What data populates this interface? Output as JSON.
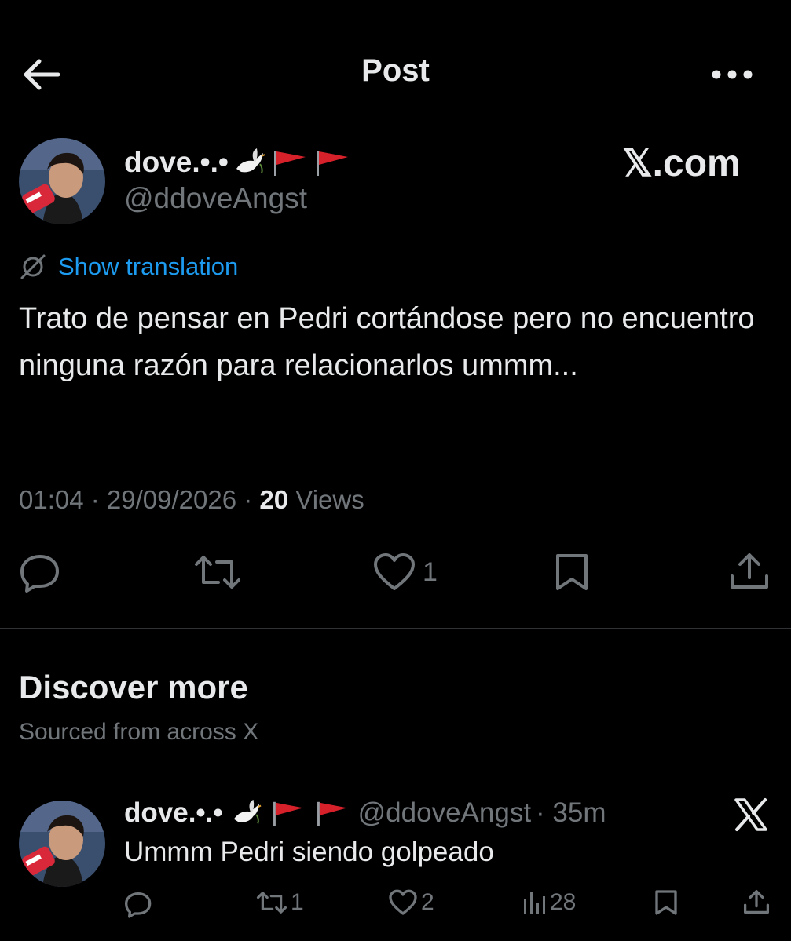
{
  "header": {
    "title": "Post"
  },
  "post": {
    "name": "dove.•.•",
    "handle": "@ddoveAngst",
    "source_badge": "𝕏.com",
    "translate_label": "Show translation",
    "text": "Trato de pensar en Pedri cortándose pero no encuentro ninguna razón para relacionarlos ummm...",
    "time": "01:04 · 29/09/2026 · ",
    "views_count": "20",
    "views_label": " Views",
    "likes": "1"
  },
  "discover": {
    "title": "Discover more",
    "subtitle": "Sourced from across X"
  },
  "related_post": {
    "name": "dove.•.•",
    "handle": "@ddoveAngst",
    "time": "· 35m",
    "text": "Ummm Pedri siendo golpeado",
    "retweets": "1",
    "likes": "2",
    "views": "28"
  },
  "colors": {
    "accent": "#1d9bf0",
    "muted": "#71767b",
    "text": "#e7e9ea",
    "background": "#000000",
    "flag": "#d6212b"
  },
  "icons": [
    "back-arrow-icon",
    "more-icon",
    "dove-icon",
    "red-flag-icon",
    "translate-icon",
    "reply-icon",
    "retweet-icon",
    "like-icon",
    "bookmark-icon",
    "share-icon",
    "views-icon",
    "x-logo-icon"
  ]
}
